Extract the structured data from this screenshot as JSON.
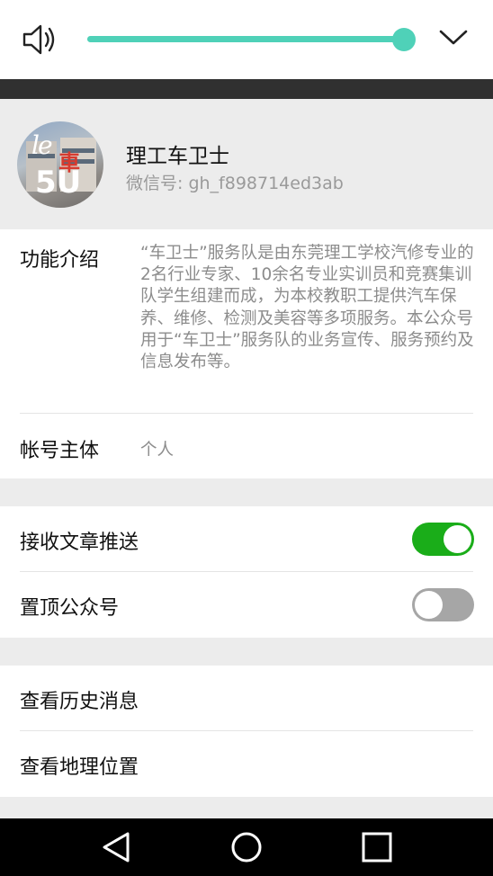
{
  "volume": {
    "level_percent": 100,
    "accent_color": "#4fd1b8",
    "speaker_icon": "speaker-icon",
    "expand_icon": "chevron-down-icon"
  },
  "profile": {
    "name": "理工车卫士",
    "wechat_id": "微信号: gh_f898714ed3ab",
    "avatar_text_top": "le",
    "avatar_text_char": "車",
    "avatar_text_bottom": "5U"
  },
  "info": {
    "intro_label": "功能介绍",
    "intro_text": "“车卫士”服务队是由东莞理工学校汽修专业的2名行业专家、10余名专业实训员和竞赛集训队学生组建而成，为本校教职工提供汽车保养、维修、检测及美容等多项服务。本公众号用于“车卫士”服务队的业务宣传、服务预约及信息发布等。",
    "account_label": "帐号主体",
    "account_value": "个人"
  },
  "settings": {
    "receive_label": "接收文章推送",
    "receive_on": true,
    "pin_label": "置顶公众号",
    "pin_on": false,
    "on_color": "#1aad19"
  },
  "links": {
    "history_label": "查看历史消息",
    "location_label": "查看地理位置"
  },
  "nav": {
    "back_icon": "back-icon",
    "home_icon": "home-icon",
    "recents_icon": "recents-icon"
  }
}
